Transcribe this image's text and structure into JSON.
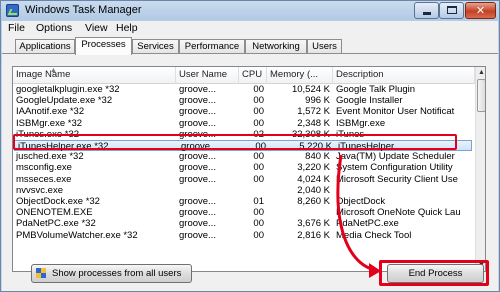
{
  "window": {
    "title": "Windows Task Manager"
  },
  "menu": [
    "File",
    "Options",
    "View",
    "Help"
  ],
  "tabs": [
    "Applications",
    "Processes",
    "Services",
    "Performance",
    "Networking",
    "Users"
  ],
  "active_tab": "Processes",
  "columns": [
    "Image Name",
    "User Name",
    "CPU",
    "Memory (...",
    "Description"
  ],
  "processes": [
    {
      "name": "googletalkplugin.exe *32",
      "user": "groove...",
      "cpu": "00",
      "mem": "10,524 K",
      "desc": "Google Talk Plugin"
    },
    {
      "name": "GoogleUpdate.exe *32",
      "user": "groove...",
      "cpu": "00",
      "mem": "996 K",
      "desc": "Google Installer"
    },
    {
      "name": "IAAnotif.exe *32",
      "user": "groove...",
      "cpu": "00",
      "mem": "1,572 K",
      "desc": "Event Monitor User Notificat"
    },
    {
      "name": "ISBMgr.exe *32",
      "user": "groove...",
      "cpu": "00",
      "mem": "2,348 K",
      "desc": "ISBMgr.exe"
    },
    {
      "name": "iTunes.exe *32",
      "user": "groove...",
      "cpu": "02",
      "mem": "32,308 K",
      "desc": "iTunes"
    },
    {
      "name": "iTunesHelper.exe *32",
      "user": "groove...",
      "cpu": "00",
      "mem": "5,220 K",
      "desc": "iTunesHelper"
    },
    {
      "name": "jusched.exe *32",
      "user": "groove...",
      "cpu": "00",
      "mem": "840 K",
      "desc": "Java(TM) Update Scheduler"
    },
    {
      "name": "msconfig.exe",
      "user": "groove...",
      "cpu": "00",
      "mem": "3,220 K",
      "desc": "System Configuration Utility"
    },
    {
      "name": "msseces.exe",
      "user": "groove...",
      "cpu": "00",
      "mem": "4,024 K",
      "desc": "Microsoft Security Client Use"
    },
    {
      "name": "nvvsvc.exe",
      "user": "",
      "cpu": "",
      "mem": "2,040 K",
      "desc": ""
    },
    {
      "name": "ObjectDock.exe *32",
      "user": "groove...",
      "cpu": "01",
      "mem": "8,260 K",
      "desc": "ObjectDock"
    },
    {
      "name": "ONENOTEM.EXE",
      "user": "groove...",
      "cpu": "00",
      "mem": "",
      "desc": "Microsoft OneNote Quick Lau"
    },
    {
      "name": "PdaNetPC.exe *32",
      "user": "groove...",
      "cpu": "00",
      "mem": "3,676 K",
      "desc": "PdaNetPC.exe"
    },
    {
      "name": "PMBVolumeWatcher.exe *32",
      "user": "groove...",
      "cpu": "00",
      "mem": "2,816 K",
      "desc": "Media Check Tool"
    }
  ],
  "selected_index": 5,
  "buttons": {
    "show_all": "Show processes from all users",
    "end_process": "End Process"
  },
  "annotation_color": "#e2001a",
  "icons": {
    "shield": "uac-shield-icon",
    "app": "task-manager-icon"
  }
}
